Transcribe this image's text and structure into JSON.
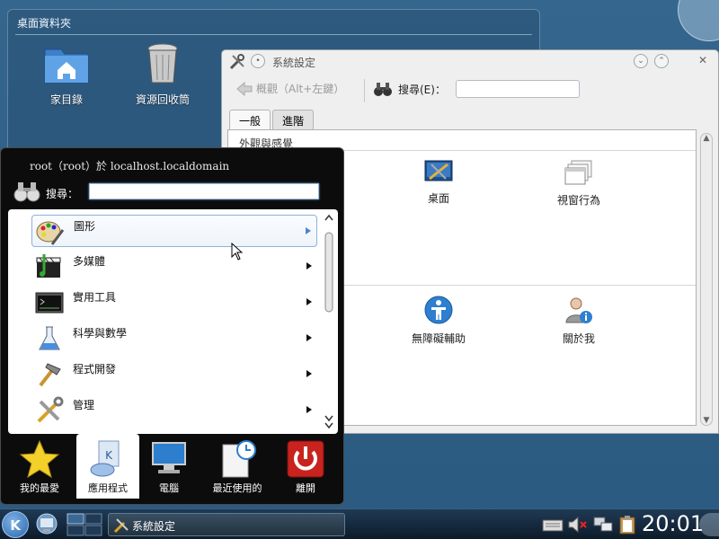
{
  "folder_view": {
    "title": "桌面資料夾",
    "icons": [
      {
        "label": "家目錄",
        "icon": "home-folder-icon"
      },
      {
        "label": "資源回收筒",
        "icon": "trash-icon"
      }
    ]
  },
  "system_settings": {
    "title": "系統設定",
    "back_label": "概觀（Alt+左鍵）",
    "search_label": "搜尋(E)：",
    "search_value": "",
    "tabs": [
      {
        "label": "一般",
        "active": true
      },
      {
        "label": "進階",
        "active": false
      }
    ],
    "categories": [
      {
        "header": "外觀與感覺",
        "modules": [
          {
            "label": "桌面",
            "icon": "desktop-icon"
          },
          {
            "label": "視窗行為",
            "icon": "window-behavior-icon"
          }
        ]
      },
      {
        "header": "",
        "modules": [
          {
            "label": "無障礙輔助",
            "icon": "accessibility-icon"
          },
          {
            "label": "關於我",
            "icon": "about-me-icon"
          }
        ]
      }
    ]
  },
  "kickoff": {
    "user_line": "root（root）於 localhost.localdomain",
    "search_label": "搜尋：",
    "search_value": "",
    "items": [
      {
        "label": "圖形",
        "icon": "graphics-icon",
        "highlighted": true
      },
      {
        "label": "多媒體",
        "icon": "multimedia-icon",
        "highlighted": false
      },
      {
        "label": "實用工具",
        "icon": "utilities-icon",
        "highlighted": false
      },
      {
        "label": "科學與數學",
        "icon": "science-icon",
        "highlighted": false
      },
      {
        "label": "程式開發",
        "icon": "development-icon",
        "highlighted": false
      },
      {
        "label": "管理",
        "icon": "administration-icon",
        "highlighted": false
      }
    ],
    "tabs": [
      {
        "label": "我的最愛",
        "icon": "favorites-star-icon",
        "active": false
      },
      {
        "label": "應用程式",
        "icon": "applications-icon",
        "active": true
      },
      {
        "label": "電腦",
        "icon": "computer-icon",
        "active": false
      },
      {
        "label": "最近使用的",
        "icon": "recent-icon",
        "active": false
      },
      {
        "label": "離開",
        "icon": "leave-icon",
        "active": false
      }
    ]
  },
  "taskbar": {
    "task_label": "系統設定",
    "clock": "20:01"
  },
  "colors": {
    "desktop": "#2f5f86",
    "highlight_border": "#8fb2d8",
    "leave_red": "#c8231e"
  }
}
